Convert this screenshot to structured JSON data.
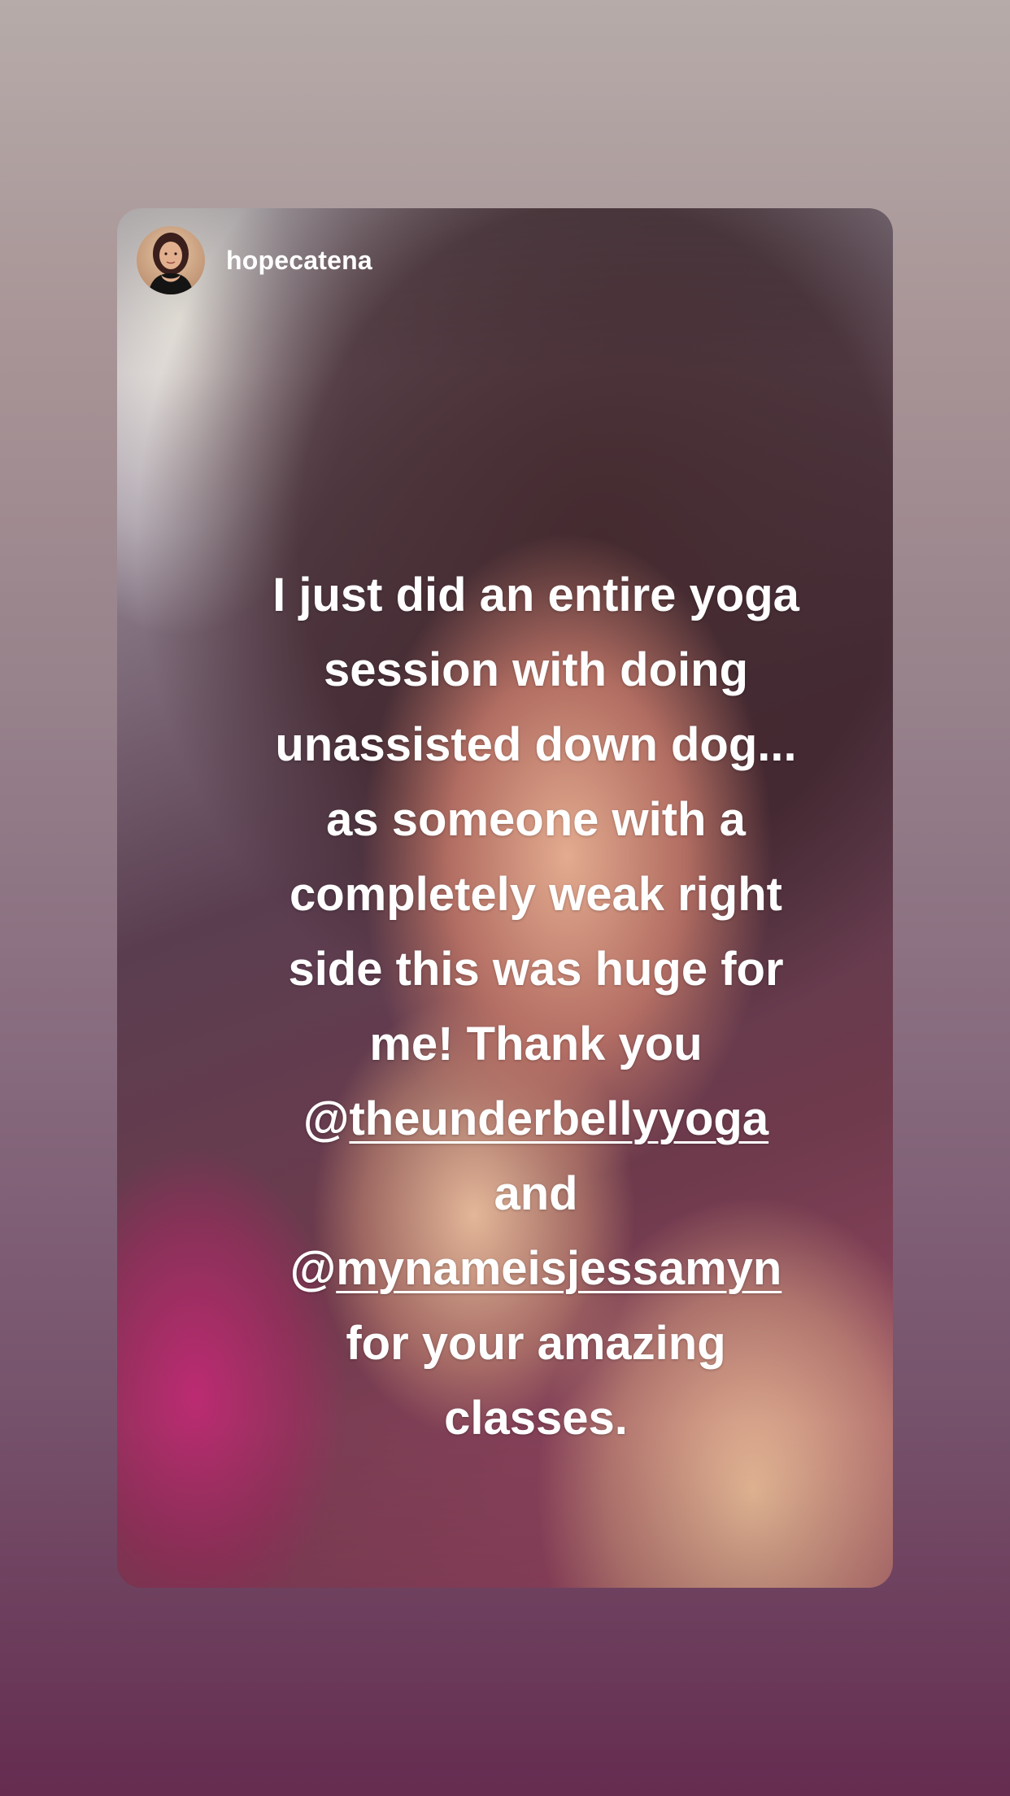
{
  "story": {
    "username": "hopecatena",
    "caption_lines": [
      "I just did an entire yoga",
      "session with doing",
      "unassisted down dog...",
      "as someone with a",
      "completely weak right",
      "side this was huge for",
      "me! Thank you"
    ],
    "mention_1_prefix": "@",
    "mention_1": "theunderbellyyoga",
    "connector": "and",
    "mention_2_prefix": "@",
    "mention_2": "mynameisjessamyn",
    "closing_lines": [
      "for your amazing",
      "classes."
    ]
  },
  "colors": {
    "background_top": "#b6aba9",
    "background_bottom": "#652c50",
    "text": "#ffffff"
  },
  "icons": {
    "avatar": "profile-photo"
  }
}
